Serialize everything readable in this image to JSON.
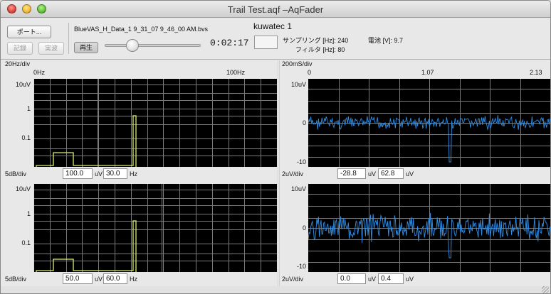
{
  "window": {
    "title": "Trail Test.aqf –AqFader"
  },
  "toolbar": {
    "port_button": "ポート...",
    "record_button": "記録",
    "live_button": "実波",
    "play_button": "再生",
    "filename": "BlueVAS_H_Data_1 9_31_07 9_46_00 AM.bvs",
    "playback_time": "0:02:17",
    "playback_position": 0.26
  },
  "device": {
    "name": "kuwatec 1",
    "sampling_label": "サンプリング [Hz]: 240",
    "filter_label": "フィルタ [Hz]: 80",
    "battery_label": "電池 [V]: 9.7"
  },
  "spectrum": {
    "x_scale": "20Hz/div",
    "x_start": "0Hz",
    "x_end": "100Hz",
    "y_ticks": [
      "10uV",
      "1",
      "0.1"
    ],
    "y_scale": "5dB/div",
    "channels": [
      {
        "amplitude": "100.0",
        "amplitude_unit": "uV",
        "frequency": "30.0",
        "frequency_unit": "Hz",
        "color": "#d8f070",
        "marker_color": "#c86060"
      },
      {
        "amplitude": "50.0",
        "amplitude_unit": "uV",
        "frequency": "60.0",
        "frequency_unit": "Hz",
        "color": "#d8f070",
        "marker_color": "#c86060"
      }
    ]
  },
  "waveform": {
    "x_scale": "200mS/div",
    "x_ticks": [
      "0",
      "1.07",
      "2.13"
    ],
    "y_ticks": [
      "10uV",
      "0",
      "-10"
    ],
    "y_scale": "2uV/div",
    "channels": [
      {
        "offset": "-28.8",
        "offset_unit": "uV",
        "gain": "62.8",
        "gain_unit": "uV",
        "color": "#2f8fe8"
      },
      {
        "offset": "0.0",
        "offset_unit": "uV",
        "gain": "0.4",
        "gain_unit": "uV",
        "color": "#2f8fe8"
      }
    ]
  }
}
